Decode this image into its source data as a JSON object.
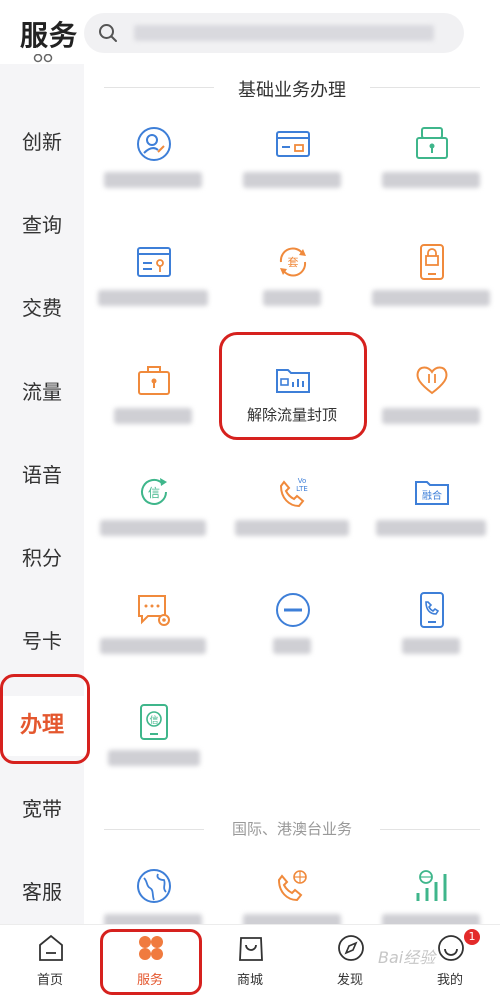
{
  "header": {
    "title": "服务",
    "search_placeholder": ""
  },
  "sidebar": {
    "items": [
      {
        "label": "创新",
        "active": false
      },
      {
        "label": "查询",
        "active": false
      },
      {
        "label": "交费",
        "active": false
      },
      {
        "label": "流量",
        "active": false
      },
      {
        "label": "语音",
        "active": false
      },
      {
        "label": "积分",
        "active": false
      },
      {
        "label": "号卡",
        "active": false
      },
      {
        "label": "办理",
        "active": true
      },
      {
        "label": "宽带",
        "active": false
      },
      {
        "label": "客服",
        "active": false
      }
    ]
  },
  "main": {
    "section1_title": "基础业务办理",
    "section2_title": "国际、港澳台业务",
    "highlight_label": "解除流量封顶",
    "icons": [
      "user-edit-icon",
      "card-lock-icon",
      "sim-lock-icon",
      "card-key-icon",
      "package-swap-icon",
      "phone-lock-icon",
      "briefcase-lock-icon",
      "folder-chart-icon",
      "heart-transfer-icon",
      "message-refresh-icon",
      "volte-phone-icon",
      "merge-folder-icon",
      "chat-settings-icon",
      "minus-circle-icon",
      "phone-callback-icon",
      "tablet-message-icon",
      "globe-icon",
      "phone-globe-icon",
      "globe-signal-icon"
    ]
  },
  "colors": {
    "accent": "#e4572e",
    "highlight_border": "#d6211e",
    "icon_blue": "#3e7fd8",
    "icon_orange": "#f08a3c",
    "icon_green": "#3fb68b"
  },
  "bottom_nav": {
    "items": [
      {
        "label": "首页",
        "icon": "home-icon"
      },
      {
        "label": "服务",
        "icon": "service-grid-icon"
      },
      {
        "label": "商城",
        "icon": "shopping-bag-icon"
      },
      {
        "label": "发现",
        "icon": "compass-icon"
      },
      {
        "label": "我的",
        "icon": "profile-icon"
      }
    ],
    "badge_count": "1"
  },
  "watermark": "Bai经验"
}
